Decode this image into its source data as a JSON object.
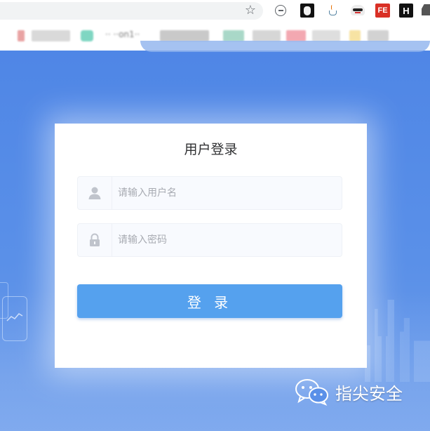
{
  "browser": {
    "bookmark_text": "·· ··on1··",
    "fe_label": "FE",
    "h_label": "H",
    "star_glyph": "☆",
    "icons": [
      "star-icon",
      "minus-circle-icon",
      "mask-icon",
      "java-icon",
      "ghost-icon",
      "fe-icon",
      "h-icon",
      "extension-icon"
    ]
  },
  "login": {
    "title": "用户登录",
    "username_placeholder": "请输入用户名",
    "password_placeholder": "请输入密码",
    "button_label": "登 录",
    "user_icon": "user-icon",
    "lock_icon": "lock-icon"
  },
  "watermark": {
    "text": "指尖安全",
    "logo_icon": "wechat-icon"
  },
  "colors": {
    "page_background": "#5b8ee6",
    "button": "#55a1ee",
    "card": "#ffffff",
    "input_background": "#f8fafe"
  }
}
